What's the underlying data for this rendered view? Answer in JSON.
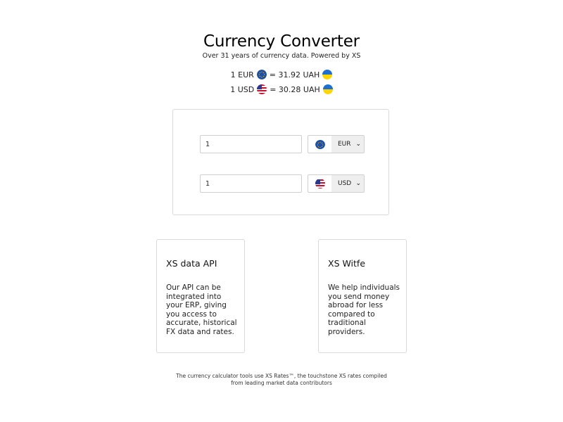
{
  "header": {
    "title": "Currency Converter",
    "subtitle": "Over 31 years of currency data. Powered by XS"
  },
  "rates": [
    {
      "base": "1 EUR",
      "result": "= 31.92 UAH",
      "base_flag": "eu-flag-icon",
      "target_flag": "ua-flag-icon"
    },
    {
      "base": "1 USD",
      "result": "= 30.28 UAH",
      "base_flag": "us-flag-icon",
      "target_flag": "ua-flag-icon"
    }
  ],
  "converter": {
    "from": {
      "amount": "1",
      "currency": "EUR",
      "flag": "eu-flag-icon"
    },
    "to": {
      "amount": "1",
      "currency": "USD",
      "flag": "us-flag-icon"
    }
  },
  "cards": [
    {
      "title": "XS data API",
      "body": "Our API can be integrated into your ERP, giving you access to accurate, historical FX data and rates."
    },
    {
      "title": "XS Witfe",
      "body": "We help individuals you send money abroad for less compared to traditional providers."
    }
  ],
  "footer": {
    "line1": "The currency calculator tools use XS Rates™, the touchstone XS rates compiled",
    "line2": "from leading market data contributors"
  },
  "colors": {
    "eu_blue": "#1f4fa3",
    "eu_star": "#f5c400",
    "ua_blue": "#1f6fd0",
    "ua_yellow": "#ffd500",
    "us_red": "#c8102e",
    "us_blue": "#2b3a8c"
  }
}
